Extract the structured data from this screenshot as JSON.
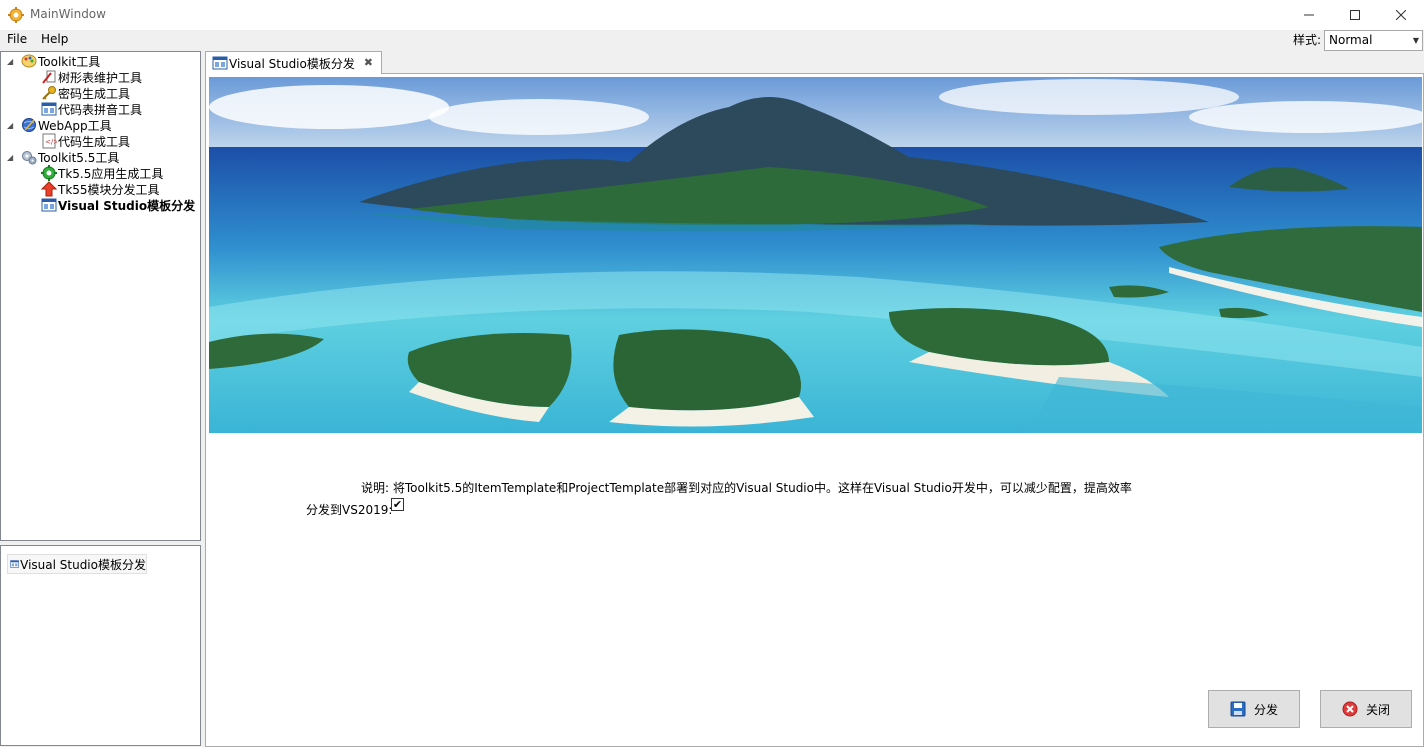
{
  "window": {
    "title": "MainWindow",
    "icon": "gear-icon"
  },
  "menu": {
    "items": [
      "File",
      "Help"
    ]
  },
  "style_selector": {
    "label": "样式:",
    "value": "Normal"
  },
  "tree": {
    "nodes": [
      {
        "label": "Toolkit工具",
        "icon": "palette-icon",
        "expanded": true
      },
      {
        "label": "树形表维护工具",
        "icon": "tree-table-icon"
      },
      {
        "label": "密码生成工具",
        "icon": "key-icon"
      },
      {
        "label": "代码表拼音工具",
        "icon": "window-icon"
      },
      {
        "label": "WebApp工具",
        "icon": "globe-icon",
        "expanded": true
      },
      {
        "label": "代码生成工具",
        "icon": "code-doc-icon"
      },
      {
        "label": "Toolkit5.5工具",
        "icon": "gears-icon",
        "expanded": true
      },
      {
        "label": "Tk5.5应用生成工具",
        "icon": "green-gear-icon"
      },
      {
        "label": "Tk55模块分发工具",
        "icon": "up-arrow-icon"
      },
      {
        "label": "Visual Studio模板分发",
        "icon": "window-icon",
        "selected": true
      }
    ]
  },
  "recent": {
    "label": "Visual Studio模板分发"
  },
  "tab": {
    "label": "Visual Studio模板分发"
  },
  "content": {
    "description": "说明: 将Toolkit5.5的ItemTemplate和ProjectTemplate部署到对应的Visual Studio中。这样在Visual Studio开发中，可以减少配置，提高效率",
    "vs2019_label": "分发到VS2019:",
    "vs2019_checked": true
  },
  "buttons": {
    "distribute": "分发",
    "close": "关闭"
  },
  "colors": {
    "selection": "#cce8ff",
    "border": "#828790",
    "close_red": "#e03b3b",
    "save_blue": "#2b6cc4"
  }
}
